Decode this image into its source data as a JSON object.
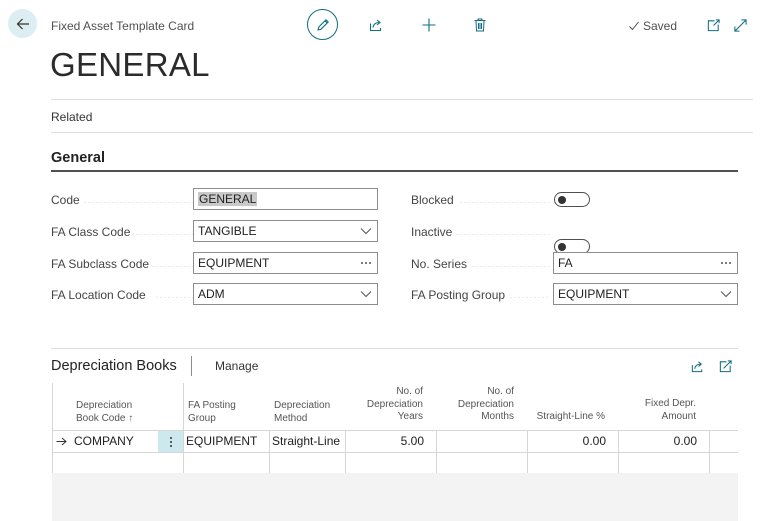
{
  "header": {
    "caption": "Fixed Asset Template Card",
    "title": "GENERAL",
    "saved_label": "Saved"
  },
  "related_label": "Related",
  "section": {
    "title": "General",
    "fields_left": [
      {
        "label": "Code",
        "value": "GENERAL",
        "control": "text"
      },
      {
        "label": "FA Class Code",
        "value": "TANGIBLE",
        "control": "dropdown"
      },
      {
        "label": "FA Subclass Code",
        "value": "EQUIPMENT",
        "control": "lookup"
      },
      {
        "label": "FA Location Code",
        "value": "ADM",
        "control": "dropdown"
      }
    ],
    "fields_right": [
      {
        "label": "Blocked",
        "toggled": false,
        "control": "toggle"
      },
      {
        "label": "Inactive",
        "toggled": false,
        "control": "toggle"
      },
      {
        "label": "No. Series",
        "value": "FA",
        "control": "lookup"
      },
      {
        "label": "FA Posting Group",
        "value": "EQUIPMENT",
        "control": "dropdown"
      }
    ]
  },
  "depreciation_books": {
    "title": "Depreciation Books",
    "manage_label": "Manage",
    "columns": {
      "book_code": [
        "Depreciation",
        "Book Code ↑"
      ],
      "posting_group": [
        "FA Posting",
        "Group"
      ],
      "method": [
        "Depreciation",
        "Method"
      ],
      "years": [
        "No. of",
        "Depreciation",
        "Years"
      ],
      "months": [
        "No. of",
        "Depreciation",
        "Months"
      ],
      "straight_line": [
        "Straight-Line %"
      ],
      "fixed_amount": [
        "Fixed Depr.",
        "Amount"
      ]
    },
    "rows": [
      {
        "book_code": "COMPANY",
        "posting_group": "EQUIPMENT",
        "method": "Straight-Line",
        "years": "5.00",
        "months": "",
        "straight_line": "0.00",
        "fixed_amount": "0.00"
      }
    ]
  },
  "colors": {
    "accent": "#0f6e80",
    "back_button_bg": "#dceef2",
    "row_action_bg": "#cde9ee"
  },
  "icons": {
    "back": "arrow-left-icon",
    "edit": "pencil-icon",
    "share": "share-icon",
    "new": "plus-icon",
    "delete": "trash-icon",
    "saved": "checkmark-icon",
    "open_new_window": "open-in-new-window-icon",
    "expand": "expand-icon"
  }
}
